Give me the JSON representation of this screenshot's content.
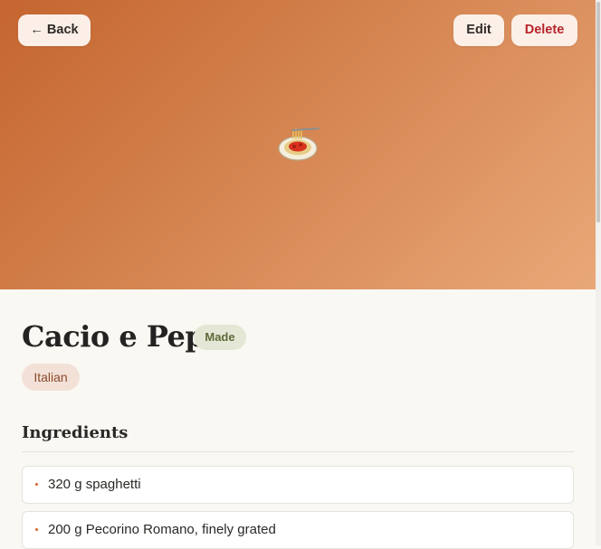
{
  "header": {
    "back_label": "← Back",
    "edit_label": "Edit",
    "delete_label": "Delete",
    "hero_icon": "spaghetti-icon"
  },
  "recipe": {
    "title": "Cacio e Pepe",
    "status": "Made",
    "tags": [
      "Italian"
    ]
  },
  "ingredients": {
    "heading": "Ingredients",
    "items": [
      "320 g spaghetti",
      "200 g Pecorino Romano, finely grated"
    ]
  },
  "colors": {
    "accent": "#c5652f",
    "delete": "#b8242a",
    "badge_made_bg": "#e5e7d6",
    "tag_bg": "#f3e1d8"
  }
}
